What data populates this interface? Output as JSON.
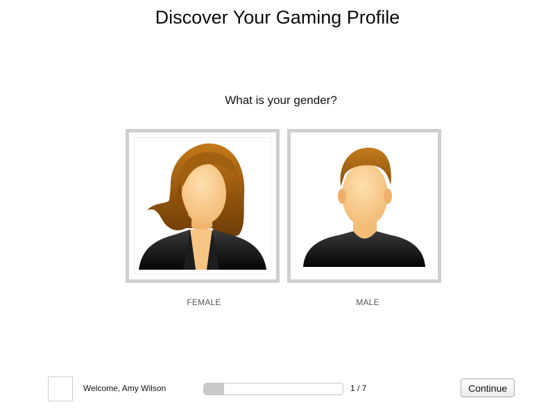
{
  "header": {
    "title": "Discover Your Gaming Profile"
  },
  "question": {
    "text": "What is your gender?"
  },
  "options": [
    {
      "label": "FEMALE",
      "icon": "female-avatar-icon"
    },
    {
      "label": "MALE",
      "icon": "male-avatar-icon"
    }
  ],
  "footer": {
    "welcome_text": "Welcome, Amy Wilson",
    "progress": {
      "current": 1,
      "total": 7,
      "label": "1 / 7"
    },
    "continue_label": "Continue"
  },
  "colors": {
    "option_border": "#cfcfcf",
    "progress_fill": "#c9c9c9",
    "hair": "#9a5a10",
    "skin": "#f7c988",
    "shirt": "#141414"
  }
}
